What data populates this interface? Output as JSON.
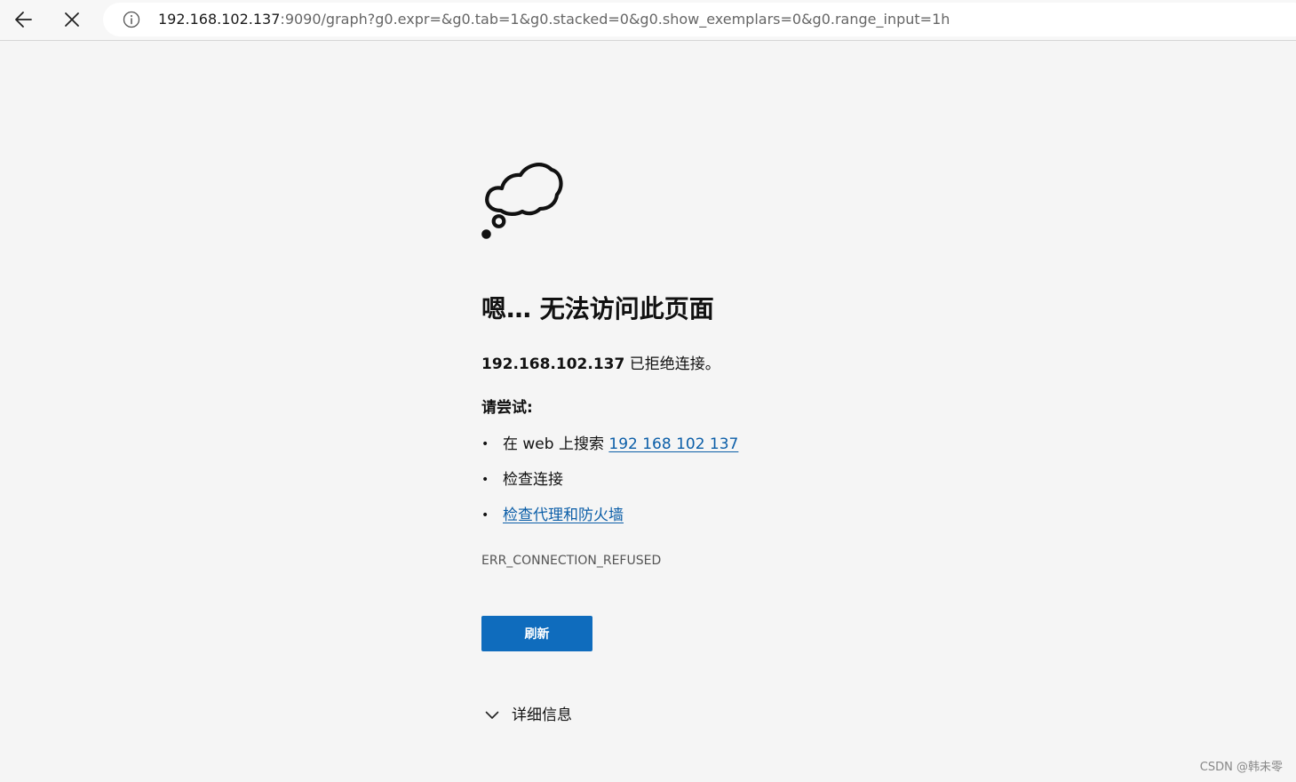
{
  "browser": {
    "back_icon": "arrow-left-icon",
    "stop_icon": "close-icon",
    "site_info_icon": "info-icon",
    "url_host": "192.168.102.137",
    "url_rest": ":9090/graph?g0.expr=&g0.tab=1&g0.stacked=0&g0.show_exemplars=0&g0.range_input=1h"
  },
  "error_page": {
    "illustration_icon": "thought-cloud-icon",
    "heading": "嗯… 无法访问此页面",
    "host": "192.168.102.137",
    "message_suffix": " 已拒绝连接。",
    "try_label": "请尝试:",
    "suggestions": [
      {
        "prefix": "在 web 上搜索 ",
        "link": "192 168 102 137"
      },
      {
        "text": "检查连接"
      },
      {
        "link": "检查代理和防火墙"
      }
    ],
    "error_code": "ERR_CONNECTION_REFUSED",
    "refresh_label": "刷新",
    "details_label": "详细信息",
    "details_icon": "chevron-down-icon"
  },
  "watermark": "CSDN @韩未零",
  "colors": {
    "page_background": "#f5f5f5",
    "link": "#0b5ea8",
    "primary_button": "#0f6cbd"
  }
}
